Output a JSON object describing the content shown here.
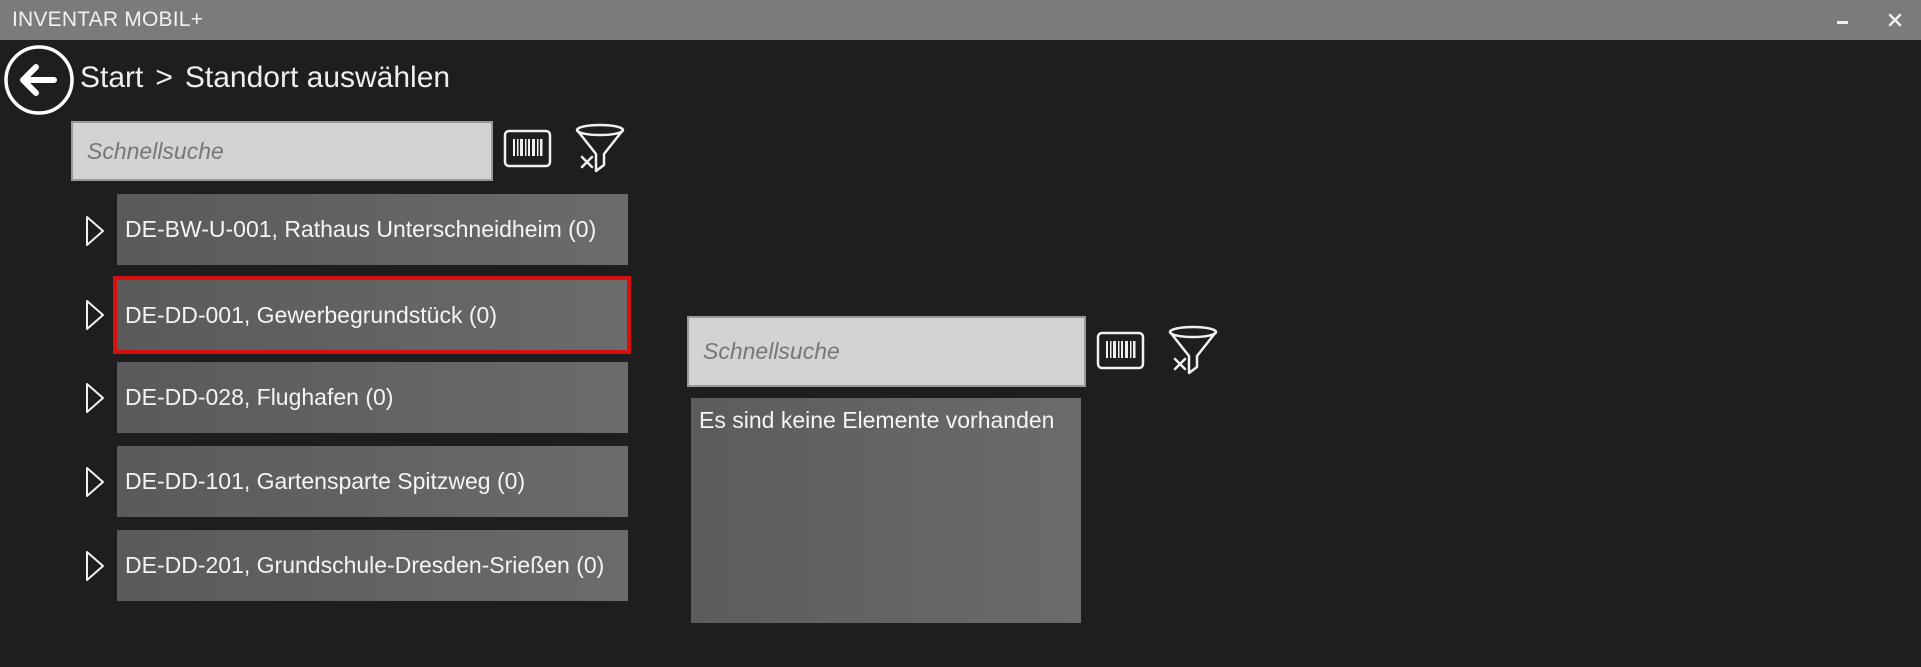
{
  "window": {
    "title": "INVENTAR MOBIL+",
    "minimize_symbol": "–",
    "close_symbol": "✕"
  },
  "breadcrumb": {
    "root": "Start",
    "separator": ">",
    "current": "Standort auswählen"
  },
  "left_panel": {
    "search_placeholder": "Schnellsuche",
    "items": [
      {
        "label": "DE-BW-U-001, Rathaus Unterschneidheim (0)",
        "selected": false
      },
      {
        "label": "DE-DD-001, Gewerbegrundstück (0)",
        "selected": true
      },
      {
        "label": "DE-DD-028, Flughafen (0)",
        "selected": false
      },
      {
        "label": "DE-DD-101, Gartensparte Spitzweg (0)",
        "selected": false
      },
      {
        "label": "DE-DD-201, Grundschule-Dresden-Srießen (0)",
        "selected": false
      }
    ]
  },
  "right_panel": {
    "search_placeholder": "Schnellsuche",
    "empty_message": "Es sind keine Elemente vorhanden"
  },
  "icons": {
    "back": "back-arrow-icon",
    "barcode": "barcode-icon",
    "filter_clear": "filter-clear-icon",
    "expand": "expand-triangle-icon"
  },
  "colors": {
    "background": "#1e1e1e",
    "titlebar": "#7b7b7b",
    "item_background": "#636363",
    "selection_border": "#d60f0f",
    "search_background": "#d3d3d3"
  }
}
